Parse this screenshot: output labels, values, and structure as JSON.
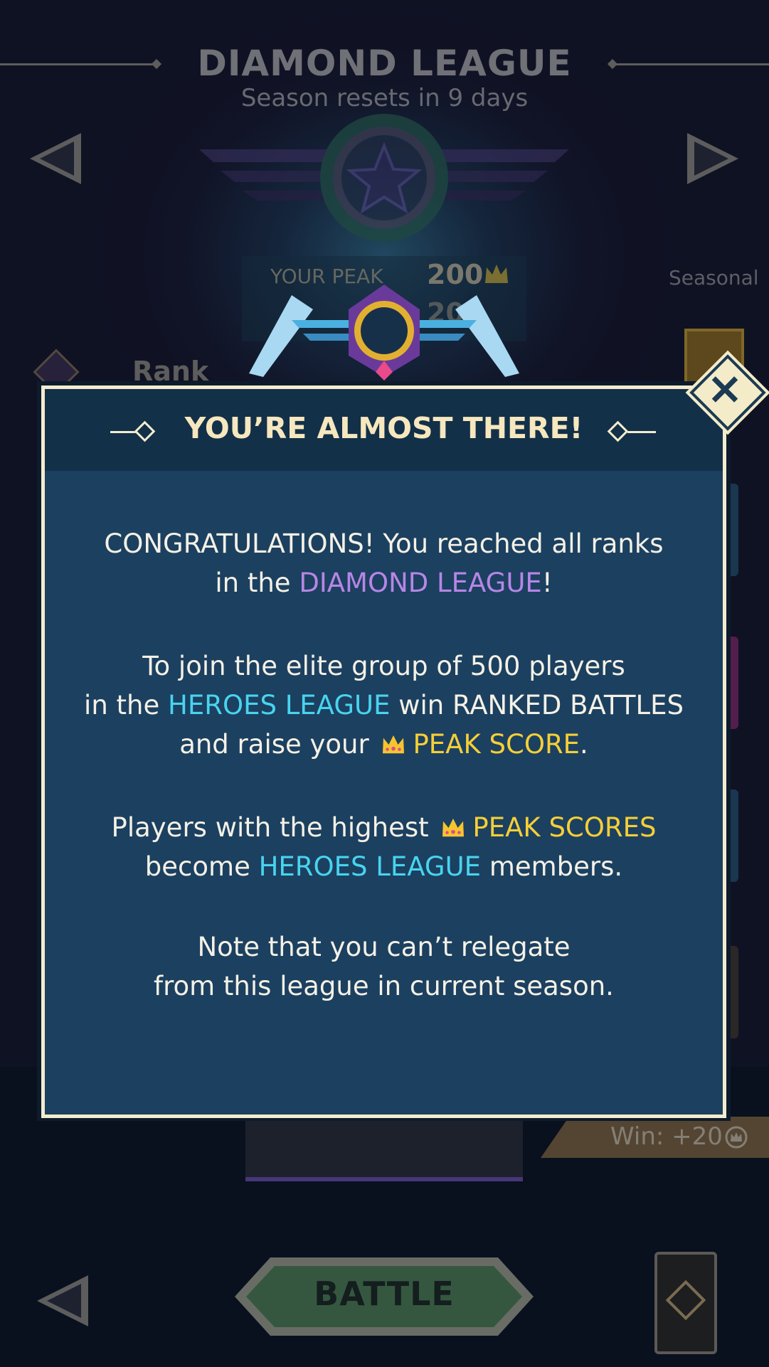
{
  "header": {
    "league_title": "DIAMOND LEAGUE",
    "season_reset": "Season resets in 9 days"
  },
  "stats": {
    "peak_label": "YOUR PEAK",
    "peak_value": "200",
    "current_value": "200",
    "seasonal_label": "Seasonal"
  },
  "rank_label": "Rank",
  "win_reward": "Win: +20",
  "battle_button": "BATTLE",
  "modal": {
    "title": "YOU’RE ALMOST THERE!",
    "close_label": "×",
    "p1_a": "CONGRATULATIONS! You reached all ranks",
    "p1_b": "in the ",
    "p1_league": "DIAMOND LEAGUE",
    "p1_end": "!",
    "p2_a": "To join the elite group of 500 players",
    "p2_b": "in the ",
    "p2_league": "HEROES LEAGUE",
    "p2_c": " win RANKED BATTLES",
    "p2_d": "and raise your ",
    "p2_peak": "PEAK SCORE",
    "p2_end": ".",
    "p3_a": "Players with the highest ",
    "p3_peak": "PEAK SCORES",
    "p3_b": "become ",
    "p3_league": "HEROES LEAGUE",
    "p3_c": " members.",
    "p4_a": "Note that you can’t relegate",
    "p4_b": "from this league in current season."
  },
  "colors": {
    "modal_bg": "#1c4060",
    "modal_border": "#f3ecce",
    "diamond_purple": "#b786e6",
    "heroes_cyan": "#48d4ef",
    "peak_gold": "#f5cf37"
  },
  "icons": [
    "crown-icon",
    "close-icon",
    "diamond-league-emblem",
    "prev-arrow-icon",
    "next-arrow-icon",
    "rank-badge-icon",
    "deck-icon"
  ]
}
